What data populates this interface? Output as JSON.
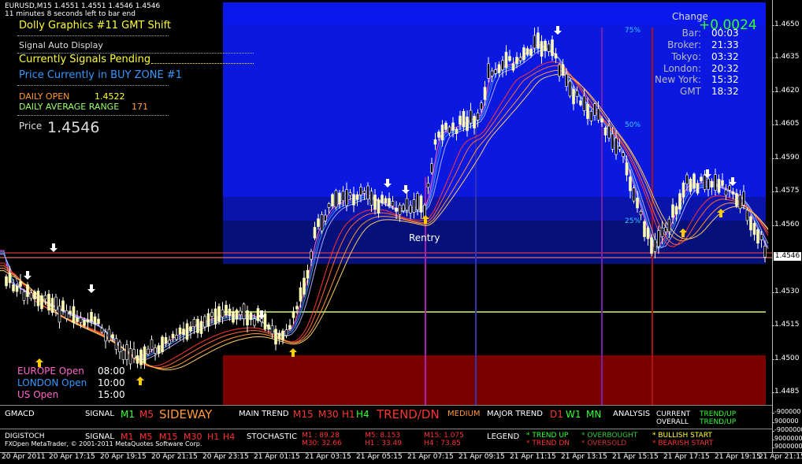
{
  "header": {
    "symbol": "EURUSD,M15  1.4551 1.4551 1.4546 1.4546",
    "bar_timer": "11 minutes 8 seconds left to bar end"
  },
  "info_panel": {
    "title": "Dolly Graphics #11 GMT Shift",
    "signal_display": "Signal Auto Display",
    "signals": "Currently Signals Pending",
    "zone": "Price Currently in BUY ZONE #1",
    "daily_open_label": "DAILY OPEN",
    "daily_open_value": "1.4522",
    "adr_label": "DAILY AVERAGE RANGE",
    "adr_value": "171",
    "price_label": "Price",
    "price_value": "1.4546"
  },
  "clock": {
    "change_label": "Change",
    "change_value": "+0.0024",
    "rows": [
      {
        "label": "Bar:",
        "value": "00:03"
      },
      {
        "label": "Broker:",
        "value": "21:33"
      },
      {
        "label": "Tokyo:",
        "value": "03:32"
      },
      {
        "label": "London:",
        "value": "20:32"
      },
      {
        "label": "New York:",
        "value": "15:32"
      },
      {
        "label": "GMT",
        "value": "18:32"
      }
    ]
  },
  "zone_labels": {
    "p75": "75%",
    "p50": "50%",
    "p25": "25%",
    "reentry": "Rentry"
  },
  "sessions": {
    "europe": {
      "label": "EUROPE Open",
      "time": "08:00"
    },
    "london": {
      "label": "LONDON Open",
      "time": "10:00"
    },
    "us": {
      "label": "US Open",
      "time": "15:00"
    }
  },
  "price_axis": {
    "ticks": [
      "1.4650",
      "1.4635",
      "1.4620",
      "1.4605",
      "1.4590",
      "1.4575",
      "1.4560",
      "1.4530",
      "1.4515",
      "1.4500",
      "1.4485"
    ],
    "current": "1.4546"
  },
  "gmacd": {
    "name": "GMACD",
    "signal_label": "SIGNAL",
    "m1": "M1",
    "m5": "M5",
    "signal_state": "SIDEWAY",
    "main_trend_label": "MAIN TREND",
    "m15": "M15",
    "m30": "M30",
    "h1": "H1",
    "h4": "H4",
    "trend_state": "TREND/DN",
    "medium": "MEDIUM",
    "major_trend_label": "MAJOR TREND",
    "d1": "D1",
    "w1": "W1",
    "mn": "MN",
    "analysis_label": "ANALYSIS",
    "current_label": "CURRENT",
    "overall_label": "OVERALL",
    "current_value": "TREND/UP",
    "overall_value": "TREND/UP",
    "axis_values": [
      "-900000",
      "900000",
      "900000"
    ]
  },
  "digistoch": {
    "name": "DIGISTOCH",
    "copyright": "FXOpen MetaTrader, © 2001-2011 MetaQuotes Software Corp.",
    "signal_label": "SIGNAL",
    "tfs": [
      "M1",
      "M5",
      "M15",
      "M30",
      "H1",
      "H4"
    ],
    "stochastic_label": "STOCHASTIC",
    "vals": [
      "M1 : 89.28",
      "M30: 32.66",
      "M5: 8.153",
      "H1 : 33.49",
      "M15: 1.075",
      "H4 : 73.85"
    ],
    "legend_label": "LEGEND",
    "legend": [
      "* TREND UP",
      "* TREND DN",
      "* OVERBOUGHT",
      "* OVERSOLD",
      "* BULLISH START",
      "* BEARISH START"
    ],
    "axis_values": [
      "-9000000",
      "9000000",
      "9000000"
    ]
  },
  "time_axis": [
    "20 Apr 2011",
    "20 Apr 17:15",
    "20 Apr 19:15",
    "20 Apr 21:15",
    "20 Apr 23:15",
    "21 Apr 01:15",
    "21 Apr 03:15",
    "21 Apr 05:15",
    "21 Apr 07:15",
    "21 Apr 09:15",
    "21 Apr 11:15",
    "21 Apr 13:15",
    "21 Apr 15:15",
    "21 Apr 17:15",
    "21 Apr 19:15",
    "21 Apr 21:15"
  ],
  "colors": {
    "buy_zone": "#0a14d6",
    "sell_zone": "#7a0000",
    "yellow": "#ffff33",
    "green_change": "#33ff33"
  }
}
